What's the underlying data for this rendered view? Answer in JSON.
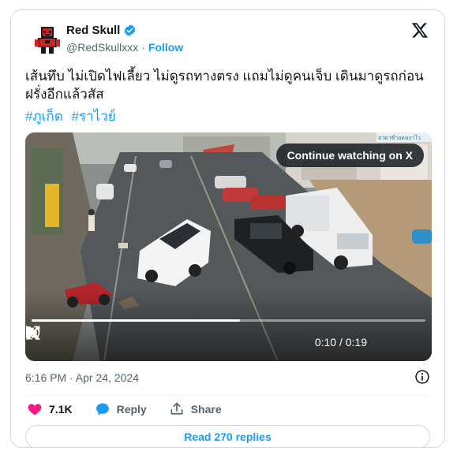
{
  "author": {
    "name": "Red Skull",
    "handle": "@RedSkullxxx",
    "follow_label": "Follow",
    "verified": true
  },
  "tweet": {
    "text": "เส้นทึบ ไม่เปิดไฟเลี้ยว ไม่ดูรถทางตรง แถมไม่ดูคนเจ็บ เดินมาดูรถก่อนฝรั่งอีกแล้วสัส",
    "hashtags": [
      "#ภูเก็ต",
      "#ราไวย์"
    ],
    "timestamp": "6:16 PM · Apr 24, 2024"
  },
  "video": {
    "continue_label": "Continue watching on X",
    "current_time": "0:10",
    "duration": "0:19",
    "time_display": "0:10 / 0:19",
    "progress_fraction": 0.53,
    "overlay_sign_text": "ยาดาซ้ายคนราไว"
  },
  "actions": {
    "likes": "7.1K",
    "reply_label": "Reply",
    "share_label": "Share"
  },
  "replies_button": "Read 270 replies",
  "colors": {
    "accent": "#1d9bf0",
    "like": "#f91880",
    "text": "#0f1419",
    "muted": "#536471"
  }
}
